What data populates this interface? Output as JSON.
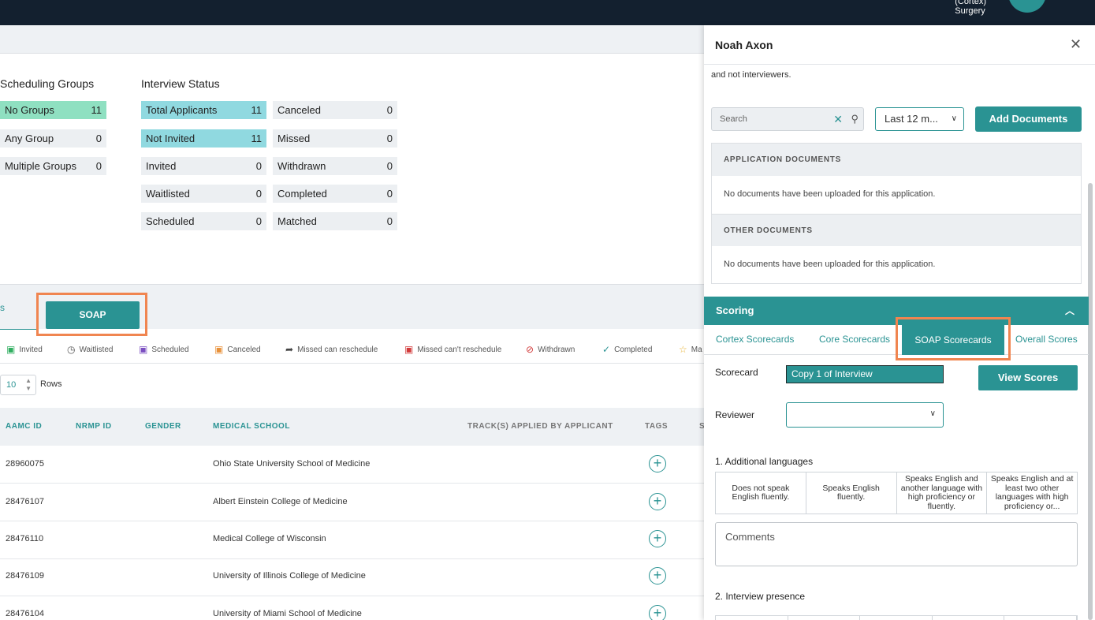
{
  "header": {
    "org_line1": "(Cortex)",
    "org_line2": "Surgery"
  },
  "scheduling_groups": {
    "title": "Scheduling Groups",
    "items": [
      {
        "label": "No Groups",
        "count": "11"
      },
      {
        "label": "Any Group",
        "count": "0"
      },
      {
        "label": "Multiple Groups",
        "count": "0"
      }
    ]
  },
  "interview_status": {
    "title": "Interview Status",
    "col1": [
      {
        "label": "Total Applicants",
        "count": "11"
      },
      {
        "label": "Not Invited",
        "count": "11"
      },
      {
        "label": "Invited",
        "count": "0"
      },
      {
        "label": "Waitlisted",
        "count": "0"
      },
      {
        "label": "Scheduled",
        "count": "0"
      }
    ],
    "col2": [
      {
        "label": "Canceled",
        "count": "0"
      },
      {
        "label": "Missed",
        "count": "0"
      },
      {
        "label": "Withdrawn",
        "count": "0"
      },
      {
        "label": "Completed",
        "count": "0"
      },
      {
        "label": "Matched",
        "count": "0"
      }
    ]
  },
  "tabs": {
    "prev_fragment": "s",
    "soap": "SOAP"
  },
  "legend": [
    "Invited",
    "Waitlisted",
    "Scheduled",
    "Canceled",
    "Missed can reschedule",
    "Missed can't reschedule",
    "Withdrawn",
    "Completed",
    "Ma"
  ],
  "rows_control": {
    "value": "10",
    "label": "Rows"
  },
  "table": {
    "columns": [
      "AAMC ID",
      "NRMP ID",
      "GENDER",
      "MEDICAL SCHOOL",
      "TRACK(S) APPLIED BY APPLICANT",
      "TAGS",
      "S"
    ],
    "rows": [
      {
        "aamc": "28960075",
        "school": "Ohio State University School of Medicine"
      },
      {
        "aamc": "28476107",
        "school": "Albert Einstein College of Medicine"
      },
      {
        "aamc": "28476110",
        "school": "Medical College of Wisconsin"
      },
      {
        "aamc": "28476109",
        "school": "University of Illinois College of Medicine"
      },
      {
        "aamc": "28476104",
        "school": "University of Miami School of Medicine"
      }
    ]
  },
  "panel": {
    "title": "Noah Axon",
    "note": "and not interviewers.",
    "search_placeholder": "Search",
    "period": "Last 12 m...",
    "add_documents": "Add Documents",
    "app_docs_header": "APPLICATION DOCUMENTS",
    "other_docs_header": "OTHER DOCUMENTS",
    "no_docs_msg": "No documents have been uploaded for this application.",
    "scoring": "Scoring",
    "score_tabs": [
      "Cortex Scorecards",
      "Core Scorecards",
      "SOAP Scorecards",
      "Overall Scores"
    ],
    "scorecard_label": "Scorecard",
    "scorecard_value": "Copy 1 of Interview",
    "view_scores": "View Scores",
    "reviewer_label": "Reviewer",
    "q1": "1. Additional languages",
    "q1_options": [
      "Does not speak English fluently.",
      "Speaks English fluently.",
      "Speaks English and another language with high proficiency or fluently.",
      "Speaks English and at least two other languages with high proficiency or..."
    ],
    "comments_placeholder": "Comments",
    "q2": "2. Interview presence"
  }
}
